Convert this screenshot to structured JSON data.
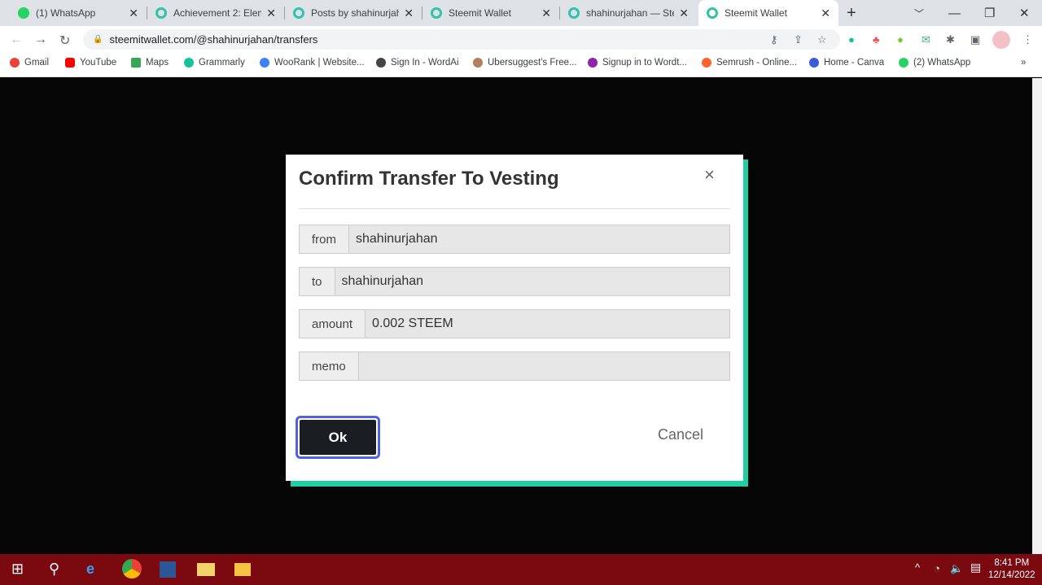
{
  "browser": {
    "tabs": [
      {
        "title": "(1) WhatsApp",
        "icon": "whatsapp-icon"
      },
      {
        "title": "Achievement 2: Eleme",
        "icon": "steemit-icon"
      },
      {
        "title": "Posts by shahinurjaha",
        "icon": "steemit-icon"
      },
      {
        "title": "Steemit Wallet",
        "icon": "steemit-icon"
      },
      {
        "title": "shahinurjahan — Stee",
        "icon": "steemit-icon"
      },
      {
        "title": "Steemit Wallet",
        "icon": "steemit-icon",
        "active": true
      }
    ],
    "url": "steemitwallet.com/@shahinurjahan/transfers",
    "bookmarks": [
      {
        "label": "Gmail",
        "color": "#ea4335"
      },
      {
        "label": "YouTube",
        "color": "#ff0000"
      },
      {
        "label": "Maps",
        "color": "#34a853"
      },
      {
        "label": "Grammarly",
        "color": "#15c39a"
      },
      {
        "label": "WooRank | Website...",
        "color": "#3b82f6"
      },
      {
        "label": "Sign In - WordAi",
        "color": "#444444"
      },
      {
        "label": "Ubersuggest's Free...",
        "color": "#b08060"
      },
      {
        "label": "Signup in to Wordt...",
        "color": "#8e24aa"
      },
      {
        "label": "Semrush - Online...",
        "color": "#ff642d"
      },
      {
        "label": "Home - Canva",
        "color": "#3b5bdb"
      },
      {
        "label": "(2) WhatsApp",
        "color": "#25d366"
      }
    ],
    "more_bookmarks": "»"
  },
  "modal": {
    "title": "Confirm Transfer To Vesting",
    "close": "×",
    "fields": [
      {
        "label": "from",
        "value": "shahinurjahan"
      },
      {
        "label": "to",
        "value": "shahinurjahan"
      },
      {
        "label": "amount",
        "value": "0.002 STEEM"
      },
      {
        "label": "memo",
        "value": ""
      }
    ],
    "ok_label": "Ok",
    "cancel_label": "Cancel",
    "accent": "#1fcfa3"
  },
  "taskbar": {
    "time": "8:41 PM",
    "date": "12/14/2022",
    "color": "#7a0a10"
  }
}
